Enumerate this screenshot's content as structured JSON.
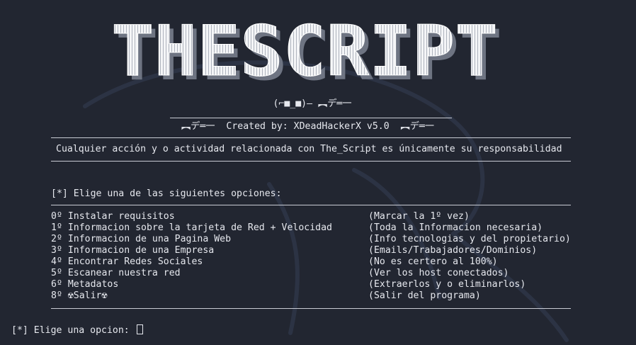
{
  "colors": {
    "background": "#222631",
    "text": "#e6e8ee",
    "logo_fill": "#f4f5f7",
    "logo_shadow": "#8d93a0"
  },
  "banner": {
    "logo_text": "THESCRIPT",
    "face": "(⌐■_■)– ︻デ═一",
    "credit_left_gun": "︻デ═一",
    "credit": "Created by: XDeadHackerX v5.0",
    "credit_right_gun": "︻デ═一"
  },
  "disclaimer": "Cualquier acción y o actividad relacionada con The_Script es únicamente su responsabilidad",
  "menu": {
    "heading": "[*] Elige una de las siguientes opciones:",
    "options": [
      {
        "label": "0º Instalar requisitos",
        "desc": "(Marcar la 1º vez)"
      },
      {
        "label": "1º Informacion sobre la tarjeta de Red + Velocidad",
        "desc": "(Toda la Informacion necesaria)"
      },
      {
        "label": "2º Informacion de una Pagina Web",
        "desc": "(Info tecnologias y del propietario)"
      },
      {
        "label": "3º Informacion de una Empresa",
        "desc": "(Emails/Trabajadores/Dominios)"
      },
      {
        "label": "4º Encontrar Redes Sociales",
        "desc": "(No es certero al 100%)"
      },
      {
        "label": "5º Escanear nuestra red",
        "desc": "(Ver los host conectados)"
      },
      {
        "label": "6º Metadatos",
        "desc": "(Extraerlos y o eliminarlos)"
      },
      {
        "label": "8º ☢Salir☢",
        "desc": "(Salir del programa)"
      }
    ]
  },
  "prompt": "[*] Elige una opcion: "
}
